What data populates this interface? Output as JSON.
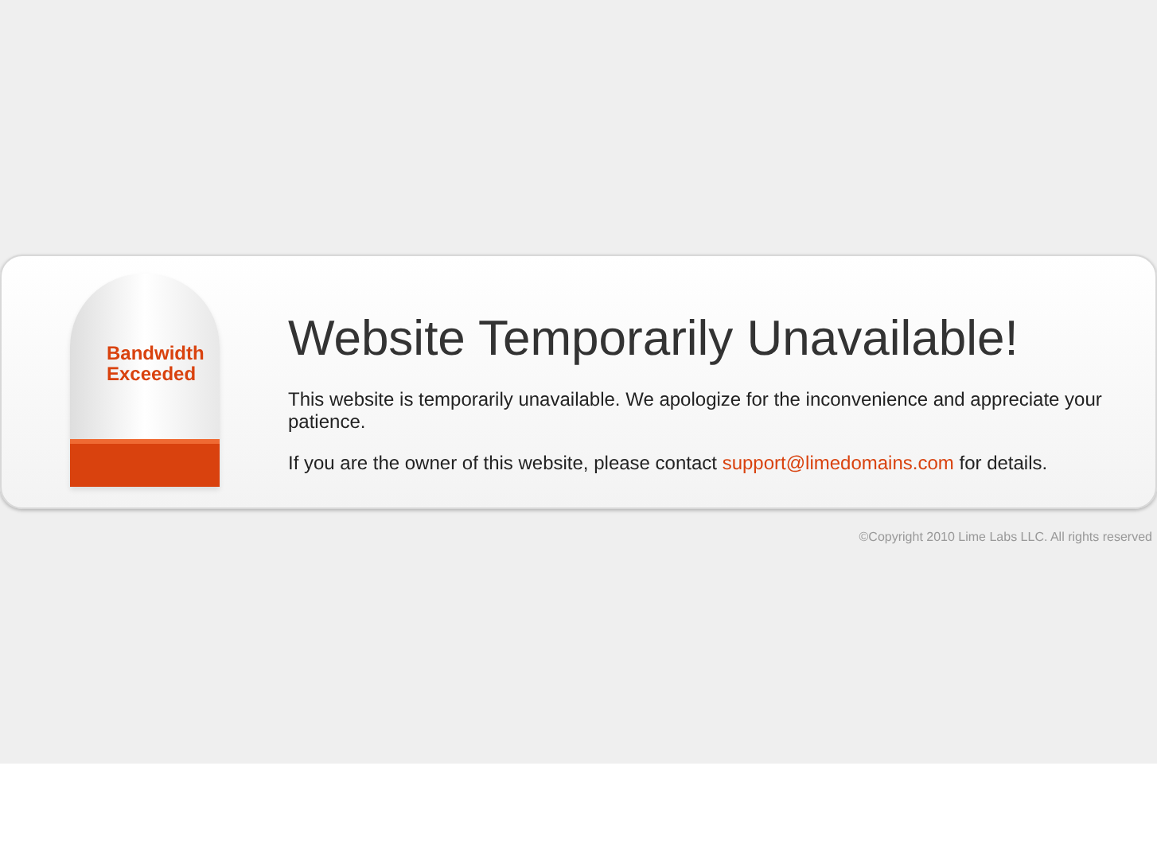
{
  "badge": {
    "label_lines": [
      "Bandwidth",
      "Exceeded"
    ]
  },
  "heading": "Website Temporarily Unavailable!",
  "message": "This website is temporarily unavailable. We apologize for the inconvenience and appreciate your patience.",
  "contact": {
    "before": "If you are the owner of this website, please contact ",
    "link": "support@limedomains.com",
    "after": " for details."
  },
  "footer": "©Copyright 2010 Lime Labs LLC. All rights reserved"
}
